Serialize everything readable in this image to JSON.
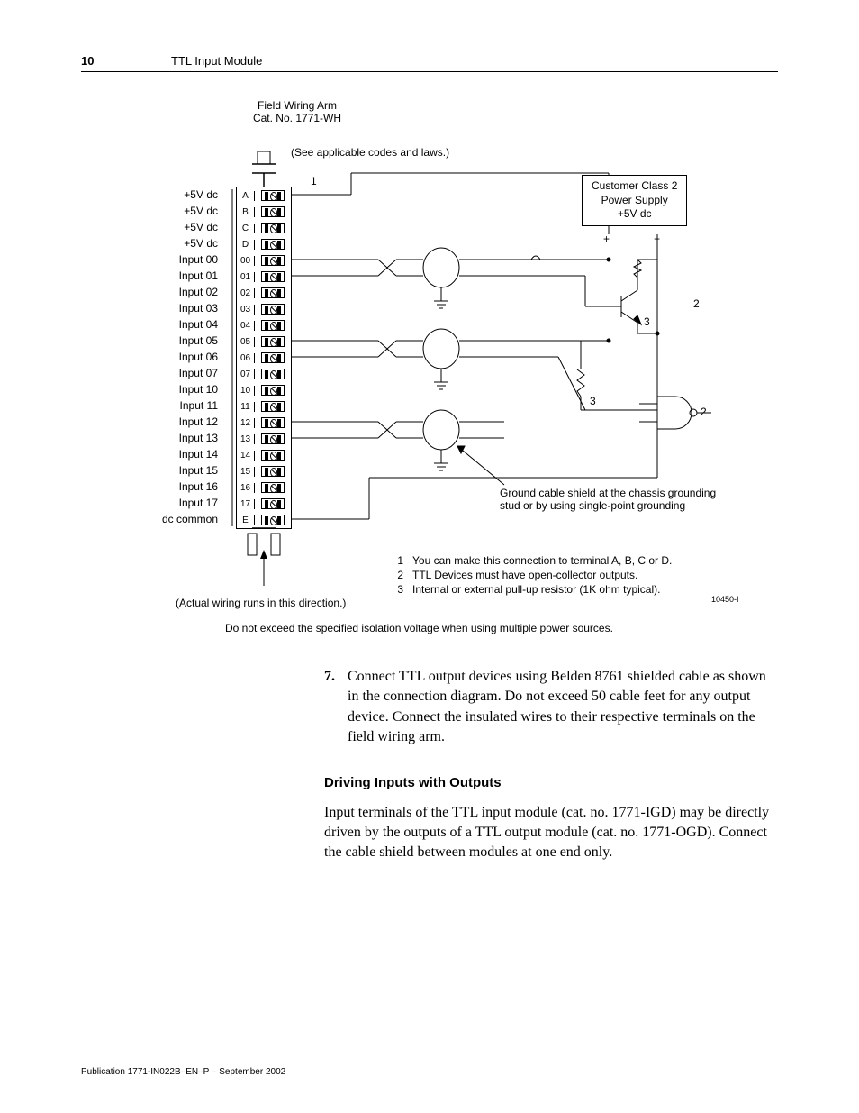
{
  "page_number": "10",
  "doc_title": "TTL Input Module",
  "figure": {
    "arm_title_1": "Field Wiring Arm",
    "arm_title_2": "Cat. No. 1771-WH",
    "codes_note": "(See applicable codes and laws.)",
    "ps_line1": "Customer Class 2",
    "ps_line2": "Power Supply",
    "ps_line3": "+5V dc",
    "plus": "+",
    "minus": "−",
    "terminals": [
      {
        "id": "A",
        "label": "+5V dc"
      },
      {
        "id": "B",
        "label": "+5V dc"
      },
      {
        "id": "C",
        "label": "+5V dc"
      },
      {
        "id": "D",
        "label": "+5V dc"
      },
      {
        "id": "00",
        "label": "Input 00"
      },
      {
        "id": "01",
        "label": "Input 01"
      },
      {
        "id": "02",
        "label": "Input 02"
      },
      {
        "id": "03",
        "label": "Input 03"
      },
      {
        "id": "04",
        "label": "Input 04"
      },
      {
        "id": "05",
        "label": "Input 05"
      },
      {
        "id": "06",
        "label": "Input 06"
      },
      {
        "id": "07",
        "label": "Input 07"
      },
      {
        "id": "10",
        "label": "Input 10"
      },
      {
        "id": "11",
        "label": "Input 11"
      },
      {
        "id": "12",
        "label": "Input 12"
      },
      {
        "id": "13",
        "label": "Input 13"
      },
      {
        "id": "14",
        "label": "Input 14"
      },
      {
        "id": "15",
        "label": "Input 15"
      },
      {
        "id": "16",
        "label": "Input 16"
      },
      {
        "id": "17",
        "label": "Input 17"
      },
      {
        "id": "E",
        "label": "dc common"
      }
    ],
    "ground_note": "Ground cable shield at the chassis grounding stud or by using single-point grounding",
    "wiring_dir": "(Actual wiring runs in this direction.)",
    "legend": [
      {
        "n": "1",
        "t": "You can make this connection to terminal A, B, C or D."
      },
      {
        "n": "2",
        "t": "TTL Devices must have open-collector outputs."
      },
      {
        "n": "3",
        "t": "Internal or external pull-up resistor (1K ohm typical)."
      }
    ],
    "fig_id": "10450-I",
    "callout_1": "1",
    "callout_2a": "2",
    "callout_2b": "2",
    "callout_3a": "3",
    "callout_3b": "3",
    "iso_note": "Do not exceed the specified isolation voltage when using multiple power sources."
  },
  "step": {
    "num": "7.",
    "text": "Connect TTL output devices using Belden 8761 shielded cable as shown in the connection diagram. Do not exceed 50 cable feet for any output device. Connect the insulated wires to their respective terminals on the field wiring arm."
  },
  "subhead": "Driving Inputs with Outputs",
  "para": "Input terminals of the TTL input module (cat. no. 1771-IGD) may be directly driven by the outputs of a TTL output module (cat. no. 1771-OGD). Connect the cable shield between modules at one end only.",
  "footer": "Publication 1771-IN022B–EN–P – September 2002"
}
